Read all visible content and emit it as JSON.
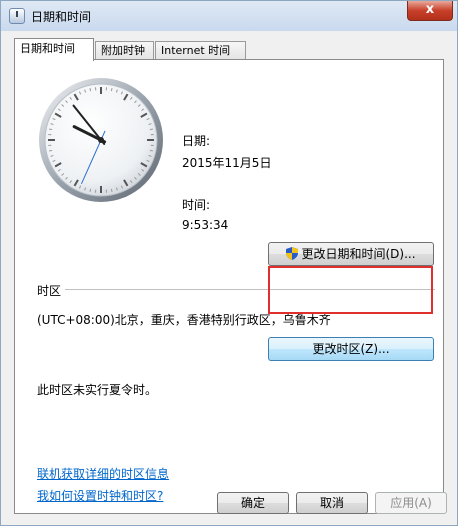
{
  "window": {
    "title": "日期和时间",
    "close_glyph": "x"
  },
  "tabs": [
    {
      "label": "日期和时间",
      "active": true
    },
    {
      "label": "附加时钟",
      "active": false
    },
    {
      "label": "Internet 时间",
      "active": false
    }
  ],
  "clock": {
    "hour": 9,
    "minute": 53,
    "second": 34
  },
  "date_section": {
    "date_label": "日期:",
    "date_value": "2015年11月5日",
    "time_label": "时间:",
    "time_value": "9:53:34"
  },
  "change_datetime_button": {
    "label": "更改日期和时间(D)...",
    "icon": "uac-shield-icon"
  },
  "timezone": {
    "section_label": "时区",
    "current": "(UTC+08:00)北京，重庆，香港特别行政区，乌鲁木齐",
    "change_button": "更改时区(Z)...",
    "dst_note": "此时区未实行夏令时。"
  },
  "links": {
    "online_info": "联机获取详细的时区信息",
    "how_to": "我如何设置时钟和时区?"
  },
  "footer": {
    "ok": "确定",
    "cancel": "取消",
    "apply": "应用(A)"
  },
  "colors": {
    "highlight_box": "#e0302e",
    "link": "#0066cc",
    "shield_blue": "#2a5cc9",
    "shield_yellow": "#f2c21a"
  }
}
